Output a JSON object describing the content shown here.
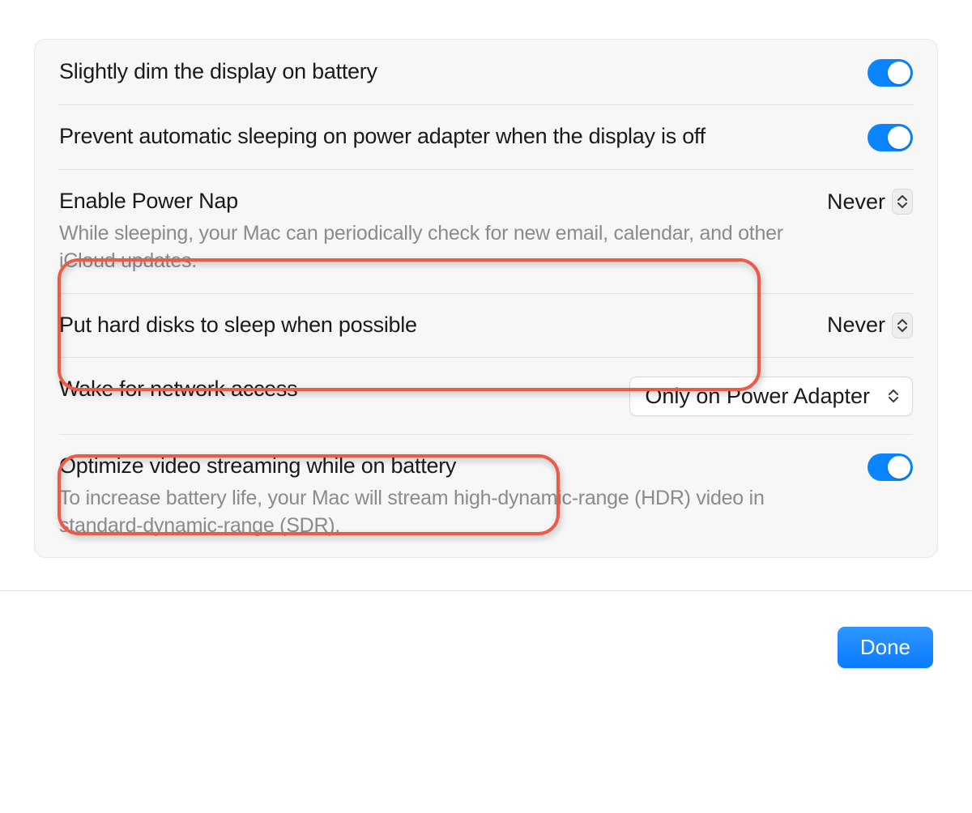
{
  "settings": {
    "dim_display": {
      "title": "Slightly dim the display on battery",
      "enabled": true
    },
    "prevent_sleep": {
      "title": "Prevent automatic sleeping on power adapter when the display is off",
      "enabled": true
    },
    "power_nap": {
      "title": "Enable Power Nap",
      "desc": "While sleeping, your Mac can periodically check for new email, calendar, and other iCloud updates.",
      "value": "Never"
    },
    "hard_disks": {
      "title": "Put hard disks to sleep when possible",
      "value": "Never"
    },
    "wake_network": {
      "title": "Wake for network access",
      "value": "Only on Power Adapter"
    },
    "optimize_video": {
      "title": "Optimize video streaming while on battery",
      "desc": "To increase battery life, your Mac will stream high-dynamic-range (HDR) video in standard-dynamic-range (SDR).",
      "enabled": true
    }
  },
  "footer": {
    "done_label": "Done"
  }
}
